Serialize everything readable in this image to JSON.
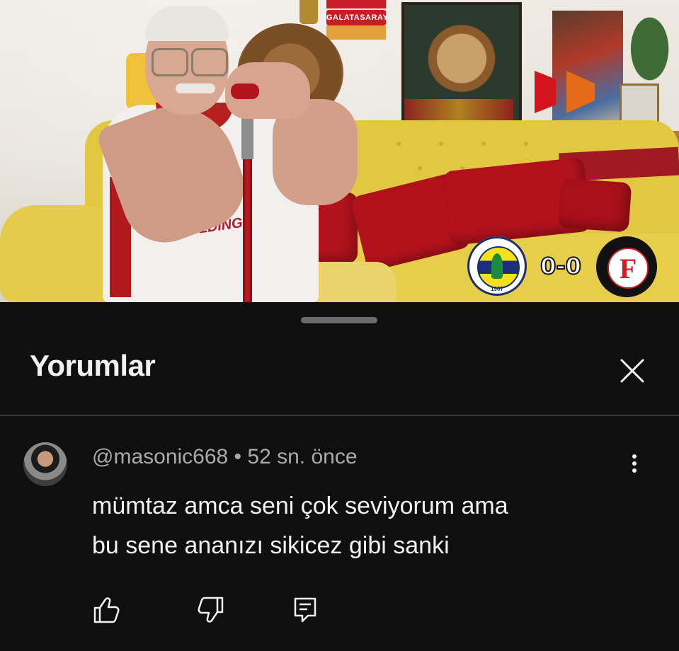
{
  "video": {
    "wall_plate_text": "GALATASARAY",
    "jersey_sponsor": "PASIFIK HOLDING",
    "scoreboard": {
      "score": "0-0",
      "home_team_year": "1907",
      "away_team_letter": "F"
    }
  },
  "comments_sheet": {
    "title": "Yorumlar",
    "comment": {
      "author": "@masonic668",
      "separator": " • ",
      "time": "52 sn. önce",
      "text_line1": "mümtaz amca seni çok seviyorum ama",
      "text_line2": "bu sene ananızı sikicez gibi sanki"
    }
  },
  "icons": {
    "close": "close-icon",
    "more": "more-vertical-icon",
    "like": "thumb-up-icon",
    "dislike": "thumb-down-icon",
    "reply": "reply-icon"
  },
  "colors": {
    "background": "#0f0f0f",
    "text_primary": "#f1f1f1",
    "text_secondary": "#aaaaaa",
    "divider": "#3a3a3a"
  }
}
